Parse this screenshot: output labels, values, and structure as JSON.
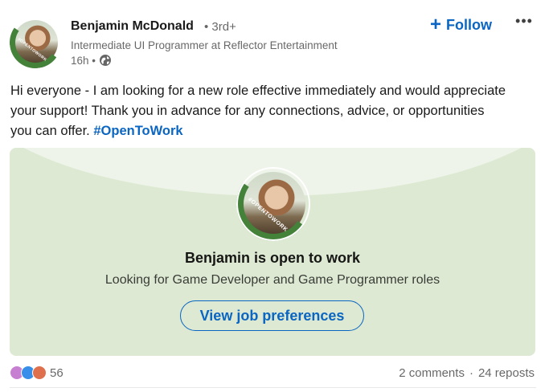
{
  "author": {
    "name": "Benjamin McDonald",
    "degree": "• 3rd+",
    "headline": "Intermediate UI Programmer at Reflector Entertainment",
    "time": "16h •",
    "badge": "#OPENTOWORK"
  },
  "actions": {
    "follow_label": "Follow",
    "follow_icon": "plus-icon",
    "more_icon": "ellipsis-icon",
    "more_glyph": "•••"
  },
  "post": {
    "text": "Hi everyone - I am looking for a new role effective immediately and would appreciate your support! Thank you in advance for any connections, advice, or opportunities you can offer. ",
    "hashtag": "#OpenToWork"
  },
  "open_to_work": {
    "title": "Benjamin is open to work",
    "subtitle": "Looking for Game Developer and Game Programmer roles",
    "button_label": "View job preferences",
    "badge": "#OPENTOWORK"
  },
  "social": {
    "reaction_count": "56",
    "comments": "2 comments",
    "separator": "·",
    "reposts": "24 reposts",
    "reaction_icons": [
      "support-icon",
      "like-icon",
      "love-icon"
    ]
  },
  "colors": {
    "accent": "#0a66c2",
    "otw_background": "#dde9d3",
    "otw_band": "#44823a"
  }
}
